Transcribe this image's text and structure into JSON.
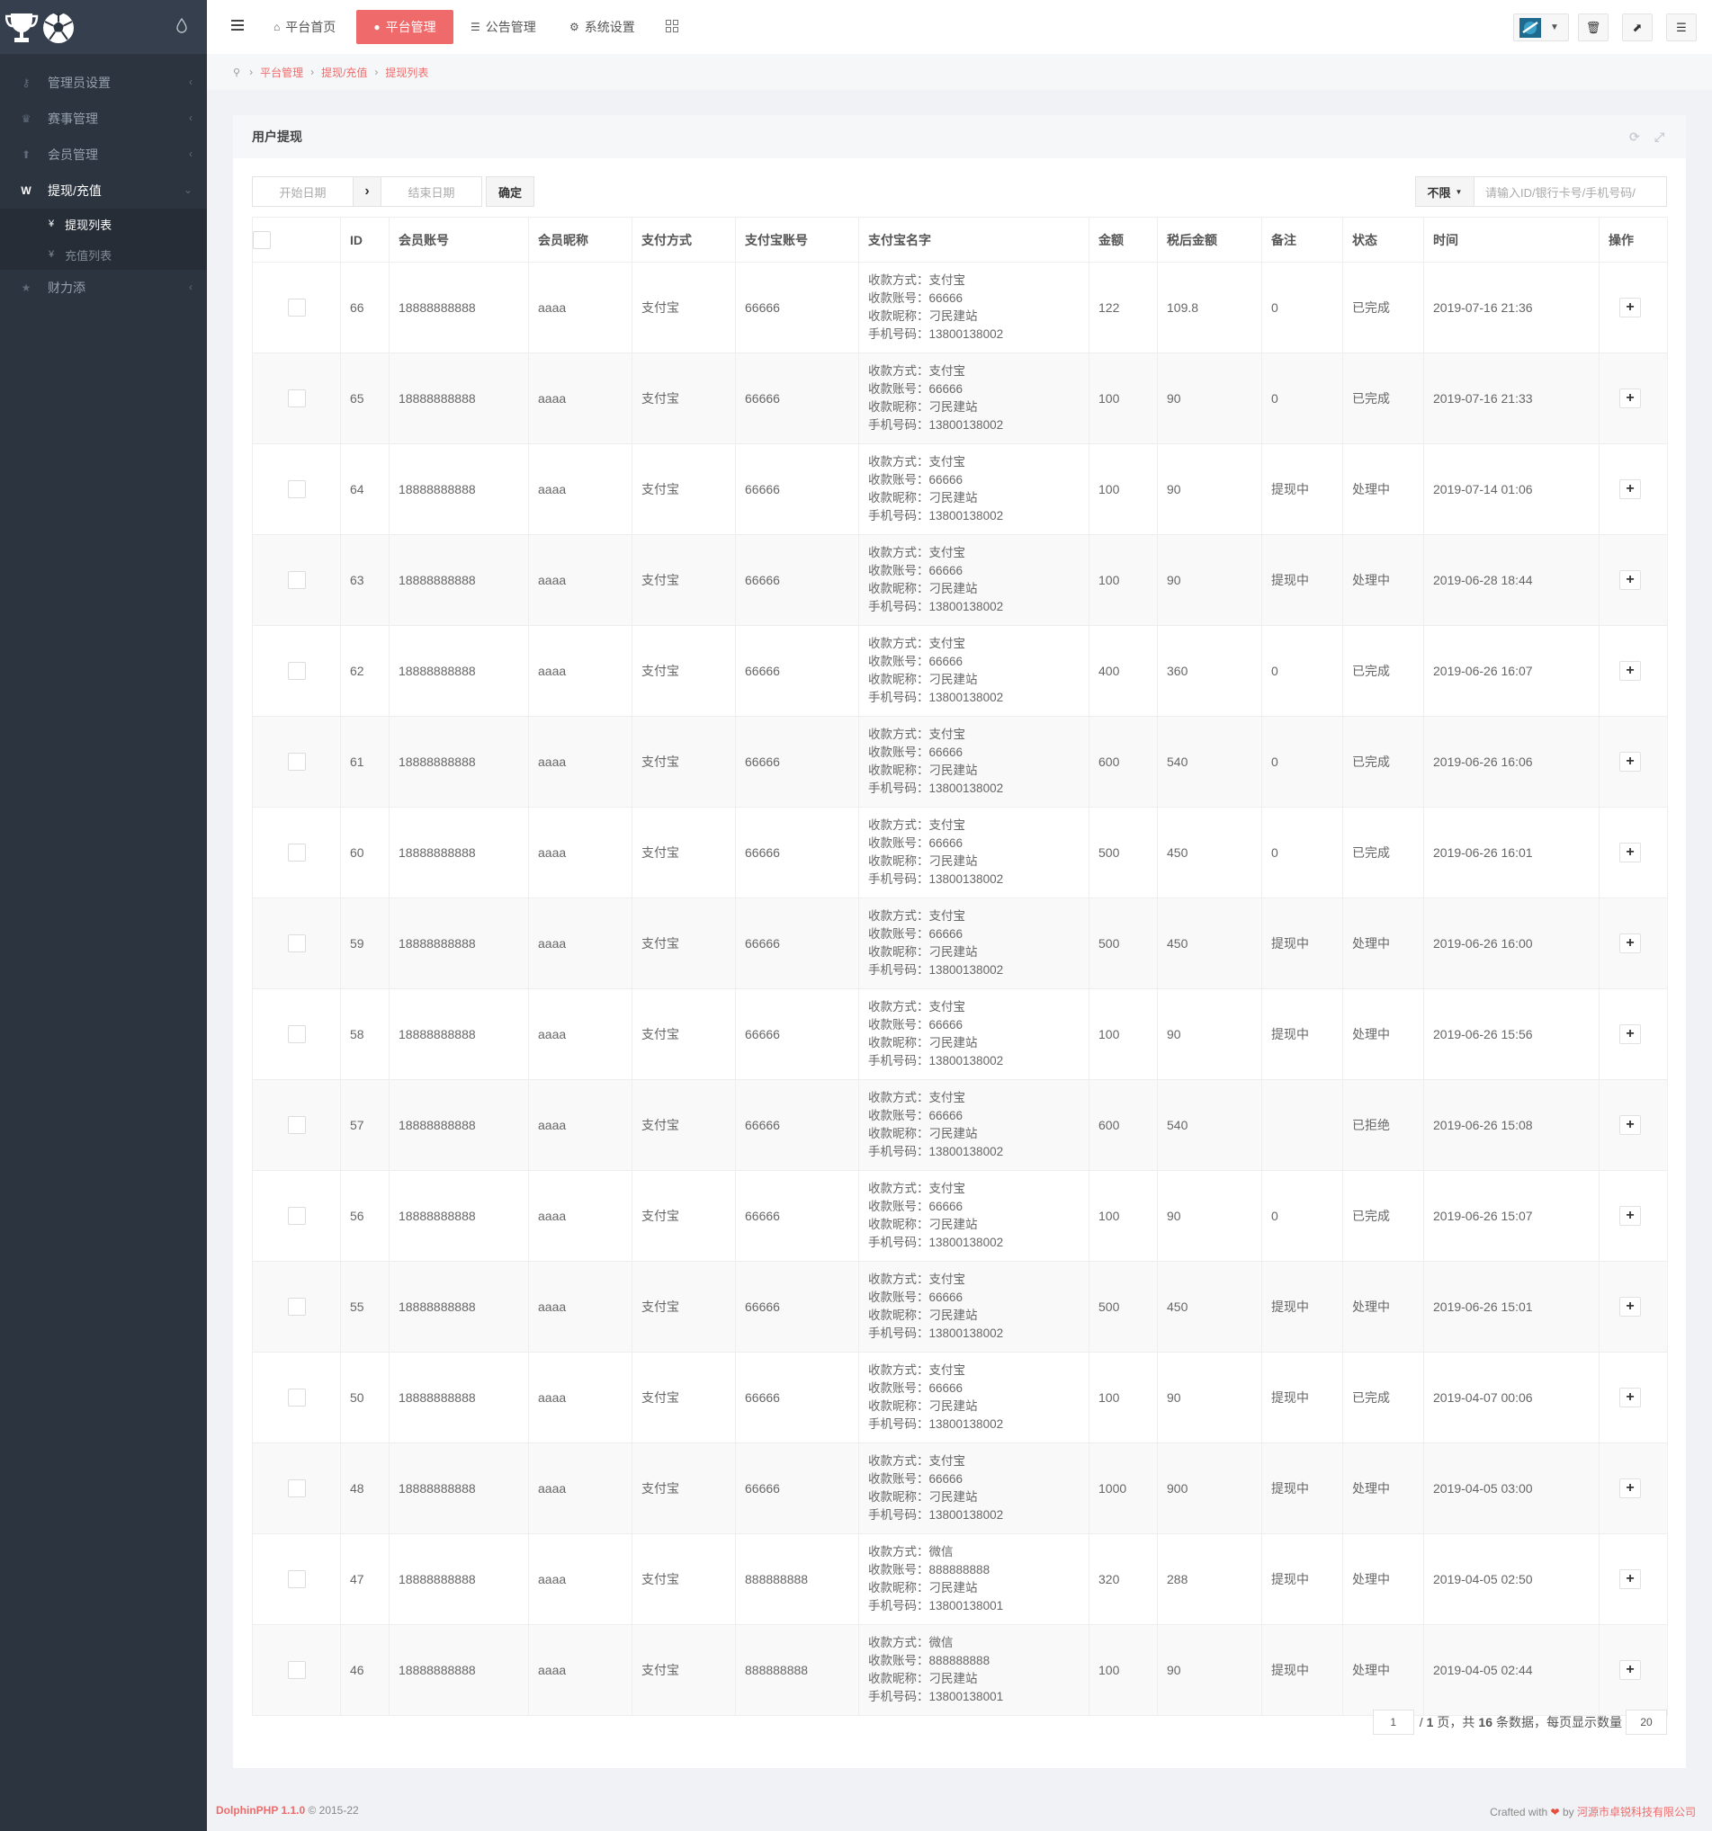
{
  "sidebar": {
    "items": [
      {
        "label": "管理员设置",
        "icon": "key-icon"
      },
      {
        "label": "赛事管理",
        "icon": "trophy-icon"
      },
      {
        "label": "会员管理",
        "icon": "upload-icon"
      },
      {
        "label": "提现/充值",
        "icon": "won-icon"
      }
    ],
    "submenu": [
      {
        "label": "提现列表",
        "icon": "yen-icon"
      },
      {
        "label": "充值列表",
        "icon": "yen-icon"
      }
    ],
    "last_item": {
      "label": "财力添",
      "icon": "star-icon"
    }
  },
  "topbar": {
    "home": "平台首页",
    "platform": "平台管理",
    "notice": "公告管理",
    "settings": "系统设置"
  },
  "breadcrumb": [
    "平台管理",
    "提现/充值",
    "提现列表"
  ],
  "panel": {
    "title": "用户提现",
    "start_date": "开始日期",
    "end_date": "结束日期",
    "confirm": "确定",
    "filter_select": "不限",
    "search_placeholder": "请输入ID/银行卡号/手机号码/"
  },
  "table": {
    "headers": [
      "ID",
      "会员账号",
      "会员昵称",
      "支付方式",
      "支付宝账号",
      "支付宝名字",
      "金额",
      "税后金额",
      "备注",
      "状态",
      "时间",
      "操作"
    ],
    "info_labels": [
      "收款方式：",
      "收款账号：",
      "收款昵称：",
      "手机号码："
    ],
    "rows": [
      {
        "id": "66",
        "account": "18888888888",
        "nickname": "aaaa",
        "pay": "支付宝",
        "alipay": "66666",
        "info": [
          "支付宝",
          "66666",
          "刁民建站",
          "13800138002"
        ],
        "amount": "122",
        "after_tax": "109.8",
        "note": "0",
        "status": "已完成",
        "time": "2019-07-16 21:36"
      },
      {
        "id": "65",
        "account": "18888888888",
        "nickname": "aaaa",
        "pay": "支付宝",
        "alipay": "66666",
        "info": [
          "支付宝",
          "66666",
          "刁民建站",
          "13800138002"
        ],
        "amount": "100",
        "after_tax": "90",
        "note": "0",
        "status": "已完成",
        "time": "2019-07-16 21:33"
      },
      {
        "id": "64",
        "account": "18888888888",
        "nickname": "aaaa",
        "pay": "支付宝",
        "alipay": "66666",
        "info": [
          "支付宝",
          "66666",
          "刁民建站",
          "13800138002"
        ],
        "amount": "100",
        "after_tax": "90",
        "note": "提现中",
        "status": "处理中",
        "time": "2019-07-14 01:06"
      },
      {
        "id": "63",
        "account": "18888888888",
        "nickname": "aaaa",
        "pay": "支付宝",
        "alipay": "66666",
        "info": [
          "支付宝",
          "66666",
          "刁民建站",
          "13800138002"
        ],
        "amount": "100",
        "after_tax": "90",
        "note": "提现中",
        "status": "处理中",
        "time": "2019-06-28 18:44"
      },
      {
        "id": "62",
        "account": "18888888888",
        "nickname": "aaaa",
        "pay": "支付宝",
        "alipay": "66666",
        "info": [
          "支付宝",
          "66666",
          "刁民建站",
          "13800138002"
        ],
        "amount": "400",
        "after_tax": "360",
        "note": "0",
        "status": "已完成",
        "time": "2019-06-26 16:07"
      },
      {
        "id": "61",
        "account": "18888888888",
        "nickname": "aaaa",
        "pay": "支付宝",
        "alipay": "66666",
        "info": [
          "支付宝",
          "66666",
          "刁民建站",
          "13800138002"
        ],
        "amount": "600",
        "after_tax": "540",
        "note": "0",
        "status": "已完成",
        "time": "2019-06-26 16:06"
      },
      {
        "id": "60",
        "account": "18888888888",
        "nickname": "aaaa",
        "pay": "支付宝",
        "alipay": "66666",
        "info": [
          "支付宝",
          "66666",
          "刁民建站",
          "13800138002"
        ],
        "amount": "500",
        "after_tax": "450",
        "note": "0",
        "status": "已完成",
        "time": "2019-06-26 16:01"
      },
      {
        "id": "59",
        "account": "18888888888",
        "nickname": "aaaa",
        "pay": "支付宝",
        "alipay": "66666",
        "info": [
          "支付宝",
          "66666",
          "刁民建站",
          "13800138002"
        ],
        "amount": "500",
        "after_tax": "450",
        "note": "提现中",
        "status": "处理中",
        "time": "2019-06-26 16:00"
      },
      {
        "id": "58",
        "account": "18888888888",
        "nickname": "aaaa",
        "pay": "支付宝",
        "alipay": "66666",
        "info": [
          "支付宝",
          "66666",
          "刁民建站",
          "13800138002"
        ],
        "amount": "100",
        "after_tax": "90",
        "note": "提现中",
        "status": "处理中",
        "time": "2019-06-26 15:56"
      },
      {
        "id": "57",
        "account": "18888888888",
        "nickname": "aaaa",
        "pay": "支付宝",
        "alipay": "66666",
        "info": [
          "支付宝",
          "66666",
          "刁民建站",
          "13800138002"
        ],
        "amount": "600",
        "after_tax": "540",
        "note": "",
        "status": "已拒绝",
        "time": "2019-06-26 15:08"
      },
      {
        "id": "56",
        "account": "18888888888",
        "nickname": "aaaa",
        "pay": "支付宝",
        "alipay": "66666",
        "info": [
          "支付宝",
          "66666",
          "刁民建站",
          "13800138002"
        ],
        "amount": "100",
        "after_tax": "90",
        "note": "0",
        "status": "已完成",
        "time": "2019-06-26 15:07"
      },
      {
        "id": "55",
        "account": "18888888888",
        "nickname": "aaaa",
        "pay": "支付宝",
        "alipay": "66666",
        "info": [
          "支付宝",
          "66666",
          "刁民建站",
          "13800138002"
        ],
        "amount": "500",
        "after_tax": "450",
        "note": "提现中",
        "status": "处理中",
        "time": "2019-06-26 15:01"
      },
      {
        "id": "50",
        "account": "18888888888",
        "nickname": "aaaa",
        "pay": "支付宝",
        "alipay": "66666",
        "info": [
          "支付宝",
          "66666",
          "刁民建站",
          "13800138002"
        ],
        "amount": "100",
        "after_tax": "90",
        "note": "提现中",
        "status": "已完成",
        "time": "2019-04-07 00:06"
      },
      {
        "id": "48",
        "account": "18888888888",
        "nickname": "aaaa",
        "pay": "支付宝",
        "alipay": "66666",
        "info": [
          "支付宝",
          "66666",
          "刁民建站",
          "13800138002"
        ],
        "amount": "1000",
        "after_tax": "900",
        "note": "提现中",
        "status": "处理中",
        "time": "2019-04-05 03:00"
      },
      {
        "id": "47",
        "account": "18888888888",
        "nickname": "aaaa",
        "pay": "支付宝",
        "alipay": "888888888",
        "info": [
          "微信",
          "888888888",
          "刁民建站",
          "13800138001"
        ],
        "amount": "320",
        "after_tax": "288",
        "note": "提现中",
        "status": "处理中",
        "time": "2019-04-05 02:50"
      },
      {
        "id": "46",
        "account": "18888888888",
        "nickname": "aaaa",
        "pay": "支付宝",
        "alipay": "888888888",
        "info": [
          "微信",
          "888888888",
          "刁民建站",
          "13800138001"
        ],
        "amount": "100",
        "after_tax": "90",
        "note": "提现中",
        "status": "处理中",
        "time": "2019-04-05 02:44"
      }
    ]
  },
  "pager": {
    "page": "1",
    "pages_text": "/",
    "total_pages": "1",
    "mid_text": "页，共",
    "total": "16",
    "tail_text": "条数据，每页显示数量",
    "per_page": "20"
  },
  "footer": {
    "brand": "DolphinPHP 1.1.0",
    "copy": "© 2015-22",
    "crafted": "Crafted with",
    "by": "by",
    "company": "河源市卓锐科技有限公司"
  },
  "colors": {
    "accent": "#ef6b6b",
    "sidebar": "#2c343f"
  }
}
